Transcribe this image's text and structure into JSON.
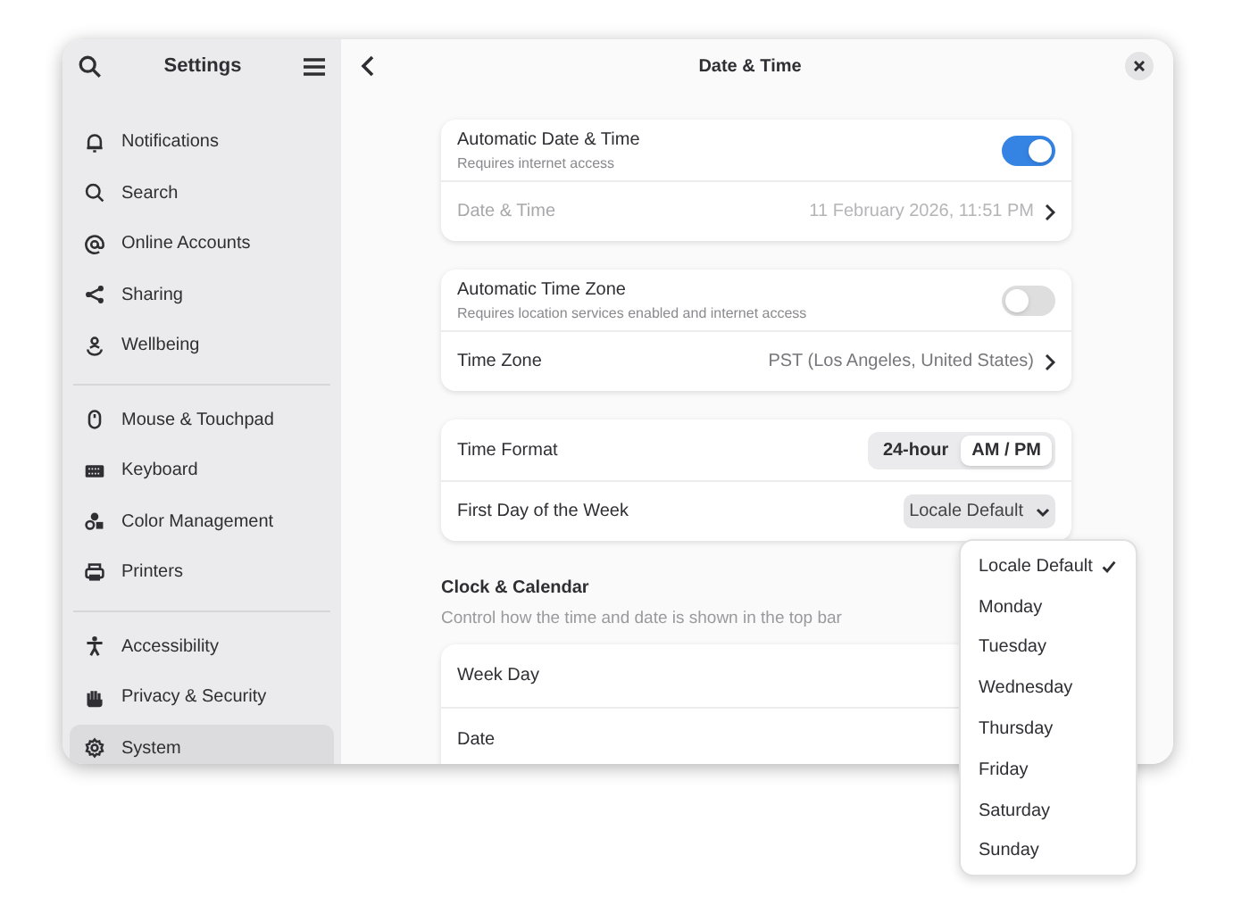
{
  "sidebar": {
    "title": "Settings",
    "groups": [
      [
        {
          "label": "Notifications",
          "selected": false
        },
        {
          "label": "Search",
          "selected": false
        },
        {
          "label": "Online Accounts",
          "selected": false
        },
        {
          "label": "Sharing",
          "selected": false
        },
        {
          "label": "Wellbeing",
          "selected": false
        }
      ],
      [
        {
          "label": "Mouse & Touchpad",
          "selected": false
        },
        {
          "label": "Keyboard",
          "selected": false
        },
        {
          "label": "Color Management",
          "selected": false
        },
        {
          "label": "Printers",
          "selected": false
        }
      ],
      [
        {
          "label": "Accessibility",
          "selected": false
        },
        {
          "label": "Privacy & Security",
          "selected": false
        },
        {
          "label": "System",
          "selected": true
        }
      ]
    ]
  },
  "page": {
    "title": "Date & Time",
    "cards": [
      [
        {
          "kind": "switch",
          "label": "Automatic Date & Time",
          "subtitle": "Requires internet access",
          "on": true
        },
        {
          "kind": "link",
          "label": "Date & Time",
          "value": "11 February 2026, 11:51 PM",
          "disabled": true
        }
      ],
      [
        {
          "kind": "switch",
          "label": "Automatic Time Zone",
          "subtitle": "Requires location services enabled and internet access",
          "on": false
        },
        {
          "kind": "link",
          "label": "Time Zone",
          "value": "PST (Los Angeles, United States)",
          "disabled": false
        }
      ],
      [
        {
          "kind": "toggles",
          "label": "Time Format",
          "options": [
            {
              "label": "24-hour",
              "selected": false
            },
            {
              "label": "AM / PM",
              "selected": true
            }
          ]
        },
        {
          "kind": "dropdown",
          "label": "First Day of the Week",
          "value": "Locale Default",
          "expanded": true
        }
      ]
    ],
    "section": {
      "title": "Clock & Calendar",
      "subtitle": "Control how the time and date is shown in the top bar",
      "rows": [
        {
          "label": "Week Day"
        },
        {
          "label": "Date"
        }
      ]
    }
  },
  "popover": {
    "items": [
      {
        "label": "Locale Default",
        "selected": true
      },
      {
        "label": "Monday",
        "selected": false
      },
      {
        "label": "Tuesday",
        "selected": false
      },
      {
        "label": "Wednesday",
        "selected": false
      },
      {
        "label": "Thursday",
        "selected": false
      },
      {
        "label": "Friday",
        "selected": false
      },
      {
        "label": "Saturday",
        "selected": false
      },
      {
        "label": "Sunday",
        "selected": false
      }
    ]
  }
}
